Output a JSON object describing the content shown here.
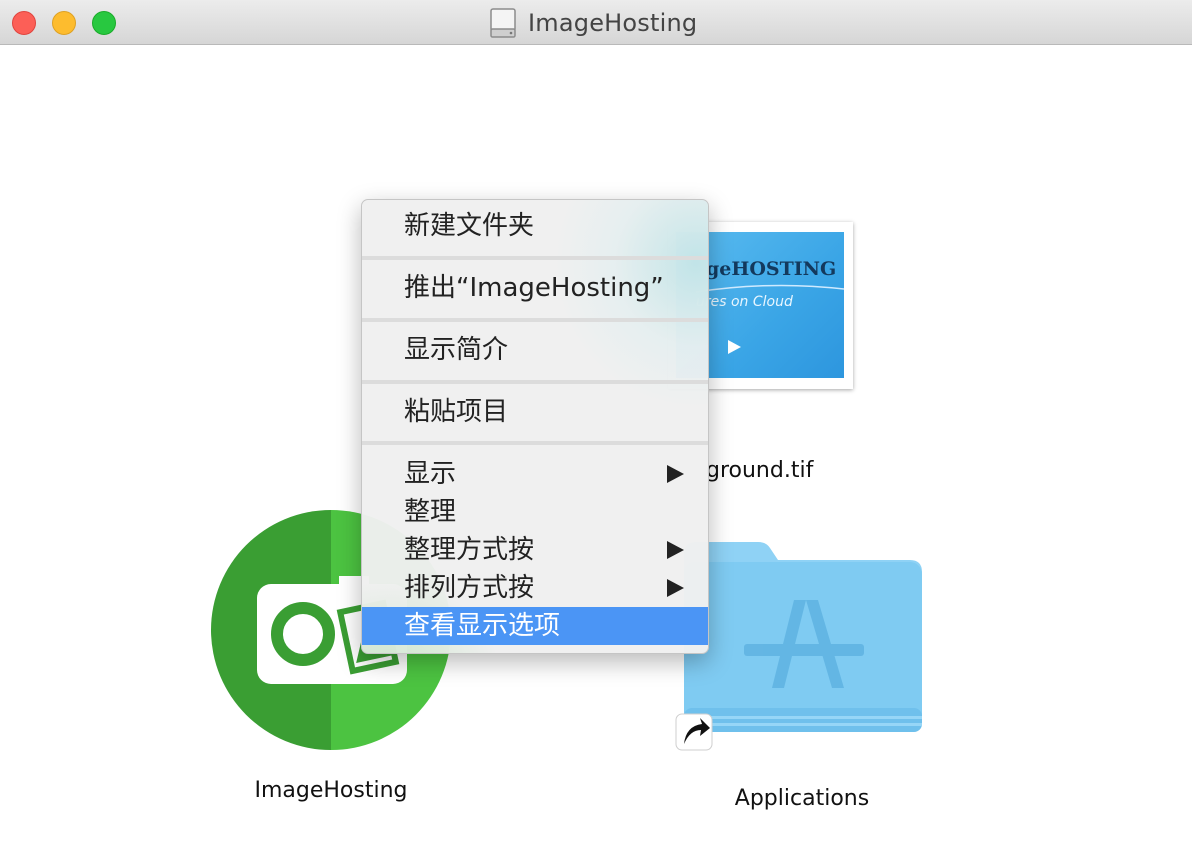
{
  "window": {
    "title": "ImageHosting"
  },
  "background_file": {
    "label": "ground.tif",
    "thumb_brand": "geHOSTING",
    "thumb_tagline": "ures on Cloud"
  },
  "app": {
    "label": "ImageHosting",
    "colors": {
      "dark": "#3a9e33",
      "light": "#4cc341"
    }
  },
  "applications_folder": {
    "label": "Applications",
    "color": "#7fcbf2"
  },
  "context_menu": {
    "items": [
      {
        "label": "新建文件夹"
      },
      {
        "label": "推出“ImageHosting”"
      },
      {
        "label": "显示简介"
      },
      {
        "label": "粘贴项目"
      },
      {
        "label": "显示",
        "submenu": true
      },
      {
        "label": "整理"
      },
      {
        "label": "整理方式按",
        "submenu": true
      },
      {
        "label": "排列方式按",
        "submenu": true
      },
      {
        "label": "查看显示选项",
        "selected": true
      }
    ],
    "selection_color": "#4b95f5"
  }
}
